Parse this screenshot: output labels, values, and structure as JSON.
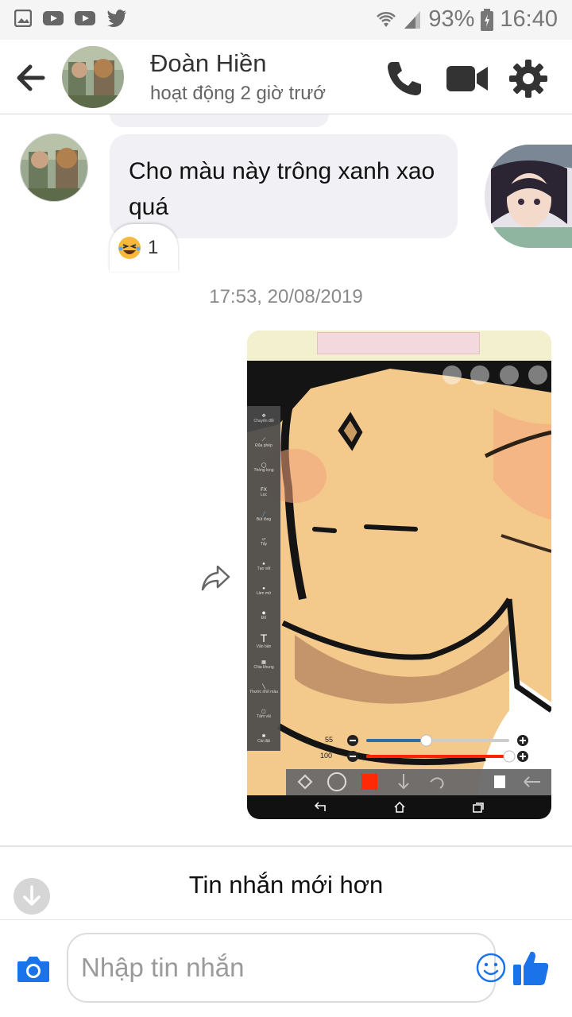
{
  "status_bar": {
    "battery": "93%",
    "time": "16:40",
    "left_icons": [
      "image-icon",
      "youtube-icon",
      "youtube-icon",
      "twitter-icon"
    ],
    "right_icons": [
      "wifi-icon",
      "signal-icon",
      "battery-icon"
    ]
  },
  "header": {
    "contact_name": "Đoàn Hiền",
    "contact_status": "hoạt động 2 giờ trướ",
    "icons": [
      "back-arrow-icon",
      "phone-icon",
      "video-call-icon",
      "gear-icon"
    ]
  },
  "conversation": {
    "incoming_message": "Cho màu này trông xanh xao quá",
    "reaction_emoji": "laughing-emoji",
    "reaction_count": "1",
    "timestamp": "17:53, 20/08/2019",
    "shared_image": {
      "description_icon": "share-icon",
      "brush_size": "55",
      "opacity": "100",
      "brush_size_fraction": 0.42,
      "opacity_fraction": 1.0,
      "selected_color": "#ff2200"
    }
  },
  "new_messages_banner": {
    "label": "Tin nhắn mới hơn"
  },
  "composer": {
    "placeholder": "Nhập tin nhắn",
    "icons": [
      "camera-icon",
      "emoji-icon",
      "thumbs-up-icon"
    ]
  },
  "colors": {
    "messenger_blue": "#1a73e8",
    "bubble_gray": "#f0f0f5",
    "icon_dark": "#333333"
  }
}
